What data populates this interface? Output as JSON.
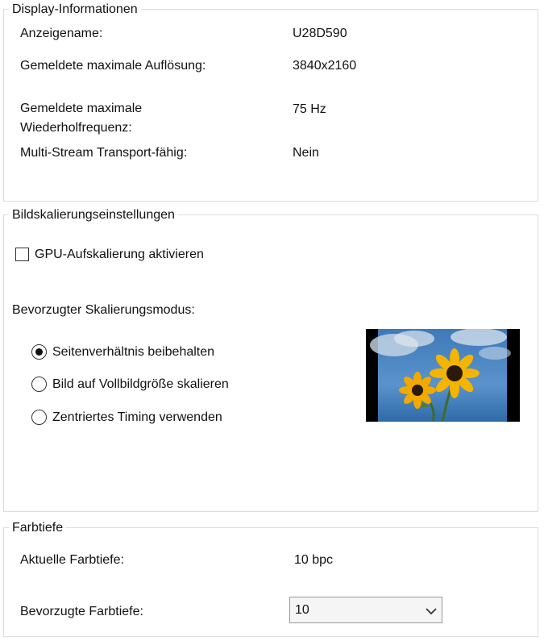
{
  "display_info": {
    "legend": "Display-Informationen",
    "rows": [
      {
        "label": "Anzeigename:",
        "value": "U28D590"
      },
      {
        "label": "Gemeldete maximale Auflösung:",
        "value": "3840x2160"
      },
      {
        "label_line1": "Gemeldete maximale",
        "label_line2": "Wiederholfrequenz:",
        "value": "75 Hz"
      },
      {
        "label": "Multi-Stream Transport-fähig:",
        "value": "Nein"
      }
    ]
  },
  "scaling": {
    "legend": "Bildskalierungseinstellungen",
    "gpu_checkbox_label": "GPU-Aufskalierung aktivieren",
    "gpu_checked": false,
    "mode_heading": "Bevorzugter Skalierungsmodus:",
    "modes": [
      {
        "label": "Seitenverhältnis beibehalten",
        "selected": true
      },
      {
        "label": "Bild auf Vollbildgröße skalieren",
        "selected": false
      },
      {
        "label": "Zentriertes Timing verwenden",
        "selected": false
      }
    ]
  },
  "color_depth": {
    "legend": "Farbtiefe",
    "current_label": "Aktuelle Farbtiefe:",
    "current_value": "10 bpc",
    "preferred_label": "Bevorzugte Farbtiefe:",
    "preferred_value": "10",
    "dropdown_icon": "chevron-down-icon"
  }
}
